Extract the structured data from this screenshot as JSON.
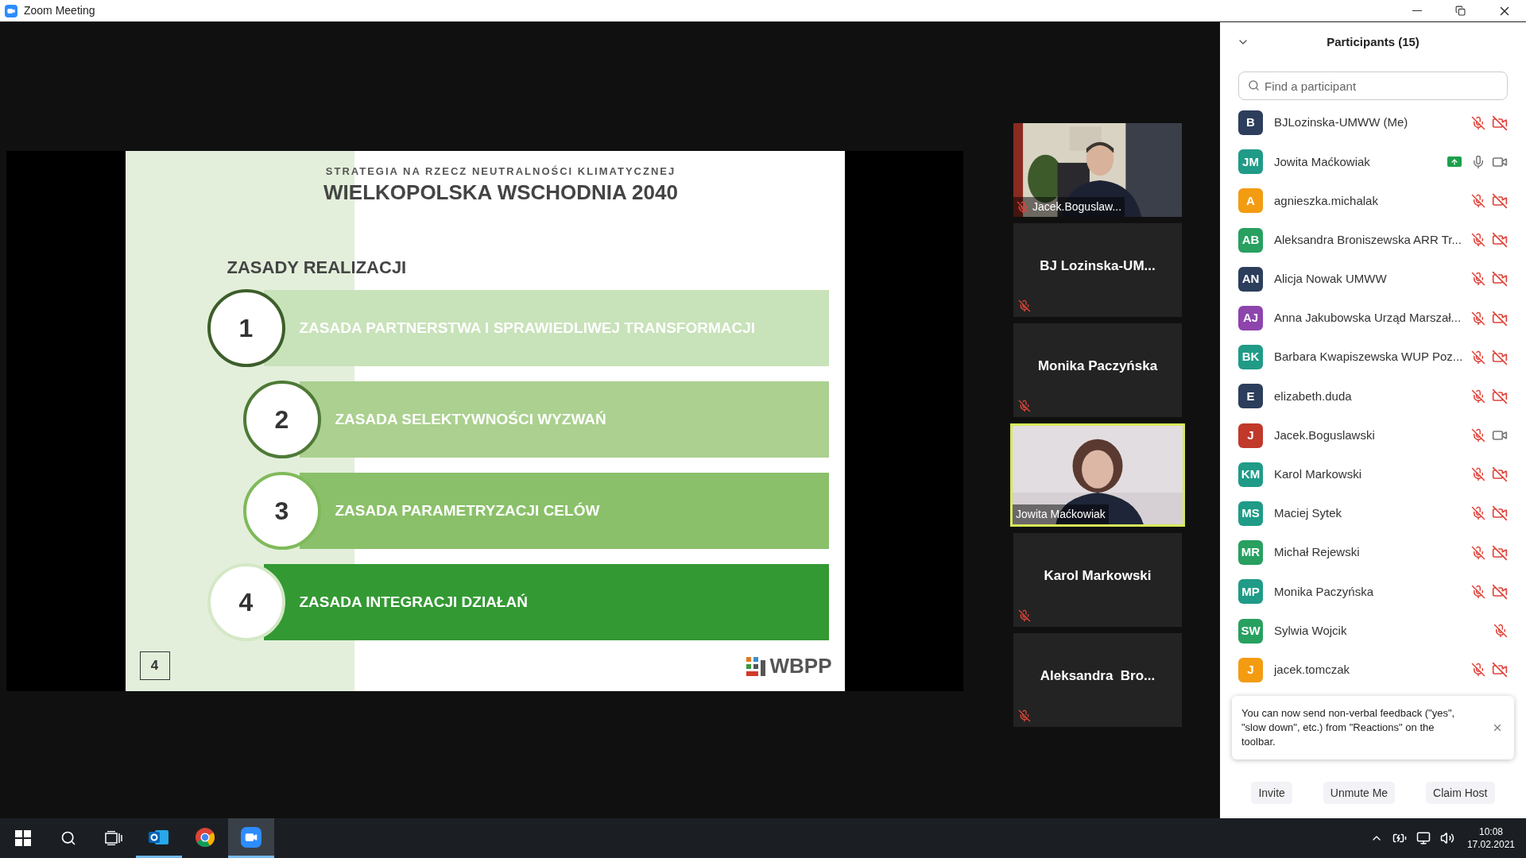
{
  "window": {
    "title": "Zoom Meeting"
  },
  "slide": {
    "subtitle": "STRATEGIA NA RZECZ NEUTRALNOŚCI KLIMATYCZNEJ",
    "title": "WIELKOPOLSKA WSCHODNIA 2040",
    "heading": "ZASADY REALIZACJI",
    "principles": [
      {
        "number": "1",
        "text": "ZASADA PARTNERSTWA I SPRAWIEDLIWEJ TRANSFORMACJI",
        "color": "#c8e2b9"
      },
      {
        "number": "2",
        "text": "ZASADA SELEKTYWNOŚCI WYZWAŃ",
        "color": "#abd08f"
      },
      {
        "number": "3",
        "text": "ZASADA PARAMETRYZACJI CELÓW",
        "color": "#8bc06a"
      },
      {
        "number": "4",
        "text": "ZASADA INTEGRACJI DZIAŁAŃ",
        "color": "#339933"
      }
    ],
    "page_number": "4",
    "logo_text": "WBPP"
  },
  "video_tiles": [
    {
      "kind": "video",
      "name": "Jacek.Boguslaw...",
      "muted": true,
      "speaking": false
    },
    {
      "kind": "name",
      "name": "BJ Lozinska-UM...",
      "muted": true,
      "speaking": false
    },
    {
      "kind": "name",
      "name": "Monika Paczyńska",
      "muted": true,
      "speaking": false
    },
    {
      "kind": "video",
      "name": "Jowita Maćkowiak",
      "muted": false,
      "speaking": true
    },
    {
      "kind": "name",
      "name": "Karol Markowski",
      "muted": true,
      "speaking": false
    },
    {
      "kind": "name",
      "name": "Aleksandra  Bro...",
      "muted": true,
      "speaking": false
    }
  ],
  "participants_panel": {
    "title": "Participants (15)",
    "search": {
      "placeholder": "Find a participant"
    },
    "participants": [
      {
        "initials": "B",
        "color": "#2c3e5c",
        "name": "BJLozinska-UMWW (Me)",
        "sharing": false,
        "mic_muted": true,
        "video_off": true
      },
      {
        "initials": "JM",
        "color": "#1f9b87",
        "name": "Jowita Maćkowiak",
        "sharing": true,
        "mic_muted": false,
        "video_off": false
      },
      {
        "initials": "A",
        "color": "#f39c12",
        "name": "agnieszka.michalak",
        "sharing": false,
        "mic_muted": true,
        "video_off": true
      },
      {
        "initials": "AB",
        "color": "#27a060",
        "name": "Aleksandra Broniszewska ARR Tr...",
        "sharing": false,
        "mic_muted": true,
        "video_off": true
      },
      {
        "initials": "AN",
        "color": "#2c3e5c",
        "name": "Alicja Nowak UMWW",
        "sharing": false,
        "mic_muted": true,
        "video_off": true
      },
      {
        "initials": "AJ",
        "color": "#8e44ad",
        "name": "Anna Jakubowska Urząd Marszał...",
        "sharing": false,
        "mic_muted": true,
        "video_off": true
      },
      {
        "initials": "BK",
        "color": "#1f9b87",
        "name": "Barbara Kwapiszewska WUP Poz...",
        "sharing": false,
        "mic_muted": true,
        "video_off": true
      },
      {
        "initials": "E",
        "color": "#2c3e5c",
        "name": "elizabeth.duda",
        "sharing": false,
        "mic_muted": true,
        "video_off": true
      },
      {
        "initials": "J",
        "color": "#c0392b",
        "name": "Jacek.Boguslawski",
        "sharing": false,
        "mic_muted": true,
        "video_off": false
      },
      {
        "initials": "KM",
        "color": "#1f9b87",
        "name": "Karol Markowski",
        "sharing": false,
        "mic_muted": true,
        "video_off": true
      },
      {
        "initials": "MS",
        "color": "#1f9b87",
        "name": "Maciej Sytek",
        "sharing": false,
        "mic_muted": true,
        "video_off": true
      },
      {
        "initials": "MR",
        "color": "#27a060",
        "name": "Michał Rejewski",
        "sharing": false,
        "mic_muted": true,
        "video_off": true
      },
      {
        "initials": "MP",
        "color": "#1f9b87",
        "name": "Monika Paczyńska",
        "sharing": false,
        "mic_muted": true,
        "video_off": true
      },
      {
        "initials": "SW",
        "color": "#27a060",
        "name": "Sylwia Wojcik",
        "sharing": false,
        "mic_muted": true
      },
      {
        "initials": "J",
        "color": "#f39c12",
        "name": "jacek.tomczak",
        "sharing": false,
        "mic_muted": true,
        "video_off": true
      }
    ],
    "tip": "You can now send non-verbal feedback (\"yes\", \"slow down\", etc.) from \"Reactions\" on the toolbar.",
    "buttons": [
      "Invite",
      "Unmute Me",
      "Claim Host"
    ]
  },
  "taskbar": {
    "apps": [
      {
        "kind": "outlook",
        "running": true,
        "selected": false
      },
      {
        "kind": "chrome",
        "running": false,
        "selected": false
      },
      {
        "kind": "zoom",
        "running": true,
        "selected": true
      }
    ],
    "time": "10:08",
    "date": "17.02.2021"
  }
}
